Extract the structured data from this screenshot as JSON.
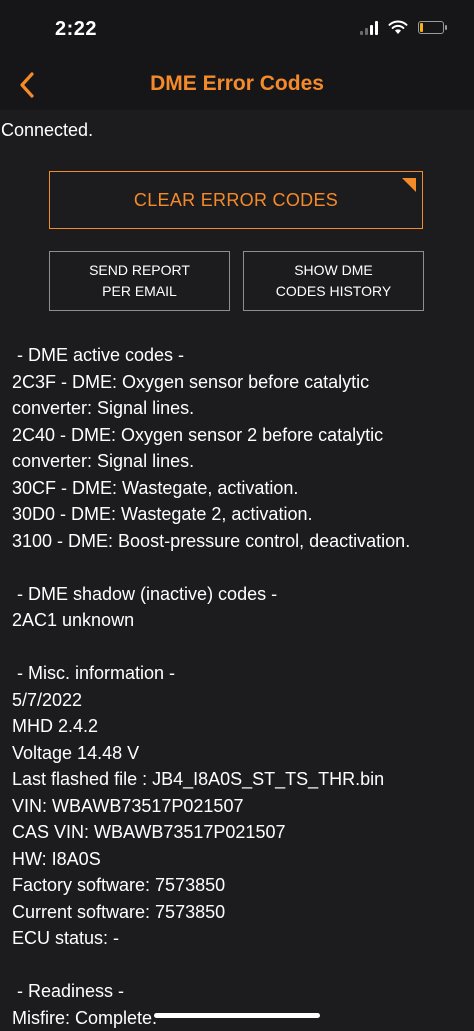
{
  "status_bar": {
    "time": "2:22"
  },
  "nav": {
    "title": "DME Error Codes"
  },
  "connection": {
    "status": "Connected."
  },
  "buttons": {
    "clear_codes": "CLEAR ERROR CODES",
    "send_report": "SEND REPORT\nPER EMAIL",
    "show_history": "SHOW DME\nCODES HISTORY"
  },
  "report": {
    "active_header": " - DME active codes -",
    "active_codes": [
      "2C3F - DME: Oxygen sensor before catalytic",
      "converter: Signal lines.",
      "2C40 - DME: Oxygen sensor 2 before catalytic",
      "converter: Signal lines.",
      "30CF - DME: Wastegate, activation.",
      "30D0 - DME: Wastegate 2, activation.",
      "3100 - DME: Boost-pressure control, deactivation."
    ],
    "shadow_header": " - DME shadow (inactive) codes -",
    "shadow_codes": [
      "2AC1 unknown"
    ],
    "misc_header": " - Misc. information -",
    "misc_lines": [
      "5/7/2022",
      "MHD 2.4.2",
      "Voltage 14.48 V",
      "Last flashed file : JB4_I8A0S_ST_TS_THR.bin",
      "VIN: WBAWB73517P021507",
      "CAS VIN: WBAWB73517P021507",
      "HW: I8A0S",
      "Factory software: 7573850",
      "Current software: 7573850",
      "ECU status: -"
    ],
    "readiness_header": " - Readiness -",
    "readiness_lines": [
      "Misfire: Complete."
    ]
  },
  "colors": {
    "accent": "#f58a2a",
    "background": "#1c1c1e",
    "text": "#ffffff",
    "border_gray": "#8e8e92"
  }
}
